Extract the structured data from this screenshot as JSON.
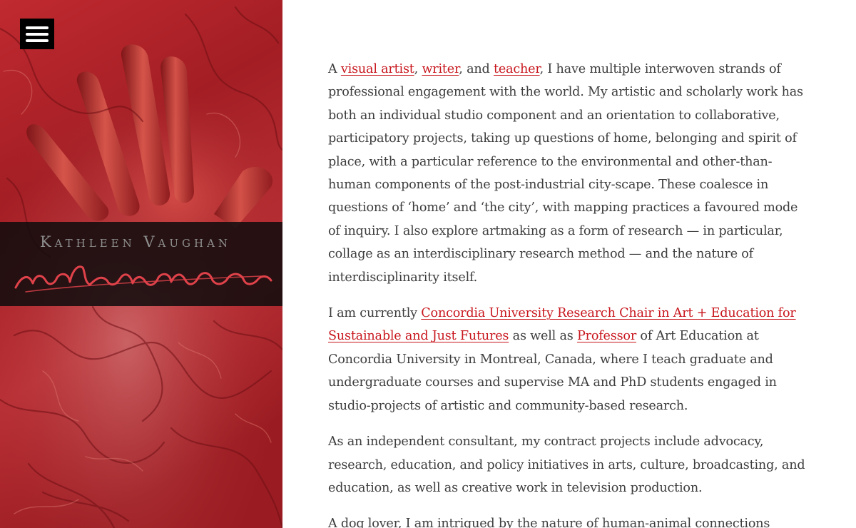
{
  "sidebar": {
    "menu_icon": "hamburger-menu-icon",
    "site_name": "Kathleen Vaughan",
    "logo_text": "redhanded",
    "artwork": "red-hand-textured-painting"
  },
  "colors": {
    "link": "#c8171e",
    "body_text": "#3d3d3d",
    "band": "#0e0c0d",
    "artwork_red": "#b5262a"
  },
  "content": {
    "p1": {
      "t1": "A ",
      "link_visual_artist": "visual artist",
      "t2": ", ",
      "link_writer": "writer",
      "t3": ", and ",
      "link_teacher": "teacher",
      "t4": ", I have multiple interwoven strands of professional engagement with the world. My artistic and scholarly work has both an individual studio component and an orientation to collaborative, participatory projects, taking up questions of home, belonging and spirit of place, with a particular reference to the environmental and other-than-human components of the post-industrial city-scape. These coalesce in questions of ‘home’ and ‘the city’, with mapping practices a favoured mode of inquiry. I also explore artmaking as a form of research — in particular, collage as an interdisciplinary research method — and the nature of interdisciplinarity itself."
    },
    "p2": {
      "t1": "I am currently ",
      "link_research_chair": "Concordia University Research Chair in Art + Education for Sustainable and Just Futures",
      "t2": " as well as ",
      "link_professor": "Professor",
      "t3": " of Art Education at Concordia University in Montreal, Canada, where I teach graduate and undergraduate courses and supervise MA and PhD students engaged in studio-projects of artistic and community-based research."
    },
    "p3": "As an independent consultant, my contract projects include advocacy, research, education, and policy initiatives in arts, culture, broadcasting, and education, as well as creative work in television production.",
    "p4": "A dog lover, I am intrigued by the nature of human-animal connections"
  }
}
